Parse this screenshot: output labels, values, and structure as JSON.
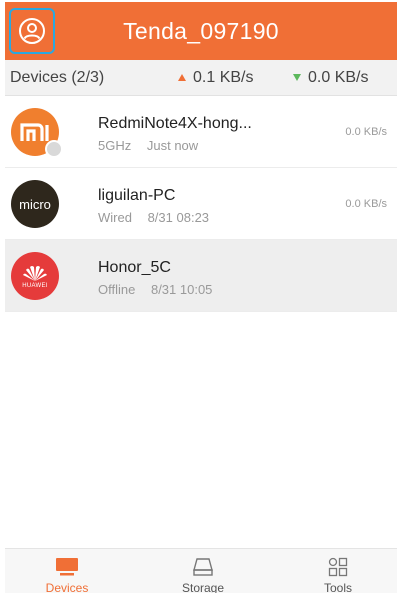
{
  "header": {
    "title": "Tenda_097190"
  },
  "stats": {
    "devices_label": "Devices (2/3)",
    "upload": "0.1 KB/s",
    "download": "0.0 KB/s"
  },
  "devices": [
    {
      "name": "RedmiNote4X-hong...",
      "band": "5GHz",
      "time": "Just now",
      "speed": "0.0 KB/s",
      "avatar_text": "mi",
      "status": "online"
    },
    {
      "name": "liguilan-PC",
      "band": "Wired",
      "time": "8/31 08:23",
      "speed": "0.0 KB/s",
      "avatar_text": "micro",
      "status": "online"
    },
    {
      "name": "Honor_5C",
      "band": "Offline",
      "time": "8/31 10:05",
      "speed": "",
      "avatar_text": "HUAWEI",
      "status": "offline"
    }
  ],
  "tabs": [
    {
      "label": "Devices",
      "icon": "monitor-icon",
      "active": true
    },
    {
      "label": "Storage",
      "icon": "storage-icon",
      "active": false
    },
    {
      "label": "Tools",
      "icon": "tools-grid-icon",
      "active": false
    }
  ],
  "colors": {
    "accent": "#f06f36",
    "selection_outline": "#2aa8e0",
    "download_arrow": "#5cb85c",
    "mi_avatar": "#f07f2e",
    "micro_avatar": "#2e271c",
    "huawei_avatar": "#e53b3b"
  }
}
